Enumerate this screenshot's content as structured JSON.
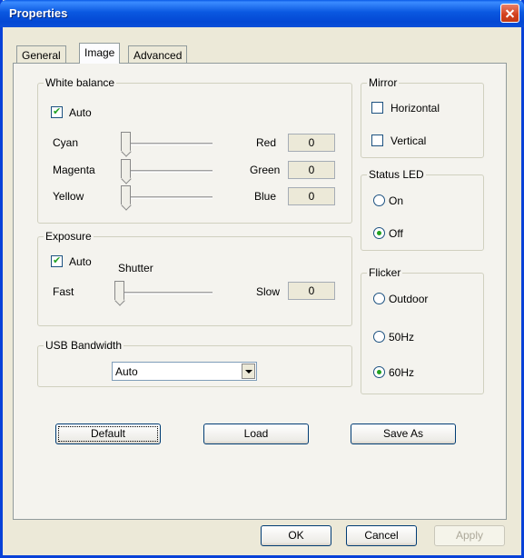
{
  "window": {
    "title": "Properties"
  },
  "tabs": [
    {
      "label": "General",
      "active": false
    },
    {
      "label": "Image",
      "active": true
    },
    {
      "label": "Advanced",
      "active": false
    }
  ],
  "white_balance": {
    "label": "White balance",
    "auto_label": "Auto",
    "auto_checked": true,
    "rows": [
      {
        "left_label": "Cyan",
        "right_label": "Red",
        "value": "0"
      },
      {
        "left_label": "Magenta",
        "right_label": "Green",
        "value": "0"
      },
      {
        "left_label": "Yellow",
        "right_label": "Blue",
        "value": "0"
      }
    ]
  },
  "exposure": {
    "label": "Exposure",
    "auto_label": "Auto",
    "auto_checked": true,
    "shutter_label": "Shutter",
    "fast_label": "Fast",
    "slow_label": "Slow",
    "value": "0"
  },
  "usb_bandwidth": {
    "label": "USB Bandwidth",
    "selected": "Auto"
  },
  "mirror": {
    "label": "Mirror",
    "horizontal_label": "Horizontal",
    "vertical_label": "Vertical",
    "horizontal_checked": false,
    "vertical_checked": false
  },
  "status_led": {
    "label": "Status LED",
    "on_label": "On",
    "off_label": "Off",
    "selected": "Off"
  },
  "flicker": {
    "label": "Flicker",
    "outdoor_label": "Outdoor",
    "hz50_label": "50Hz",
    "hz60_label": "60Hz",
    "selected": "60Hz"
  },
  "actions": {
    "default_label": "Default",
    "load_label": "Load",
    "save_as_label": "Save As"
  },
  "footer": {
    "ok_label": "OK",
    "cancel_label": "Cancel",
    "apply_label": "Apply"
  },
  "colors": {
    "titlebar": "#0a58e0",
    "dialog_bg": "#ece9d8",
    "panel_bg": "#f4f3ee",
    "check_green": "#21a121"
  }
}
